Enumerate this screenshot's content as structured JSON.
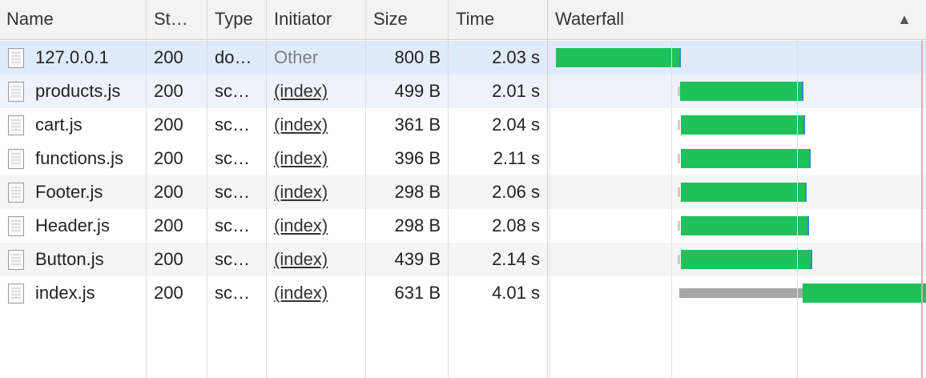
{
  "columns": {
    "name": "Name",
    "status": "St…",
    "type": "Type",
    "initiator": "Initiator",
    "size": "Size",
    "time": "Time",
    "waterfall": "Waterfall",
    "sort_indicator": "▲"
  },
  "rows": [
    {
      "name": "127.0.0.1",
      "status": "200",
      "type": "do…",
      "initiator": "Other",
      "size": "800 B",
      "time": "2.03 s"
    },
    {
      "name": "products.js",
      "status": "200",
      "type": "sc…",
      "initiator": "(index)",
      "size": "499 B",
      "time": "2.01 s"
    },
    {
      "name": "cart.js",
      "status": "200",
      "type": "sc…",
      "initiator": "(index)",
      "size": "361 B",
      "time": "2.04 s"
    },
    {
      "name": "functions.js",
      "status": "200",
      "type": "sc…",
      "initiator": "(index)",
      "size": "396 B",
      "time": "2.11 s"
    },
    {
      "name": "Footer.js",
      "status": "200",
      "type": "sc…",
      "initiator": "(index)",
      "size": "298 B",
      "time": "2.06 s"
    },
    {
      "name": "Header.js",
      "status": "200",
      "type": "sc…",
      "initiator": "(index)",
      "size": "298 B",
      "time": "2.08 s"
    },
    {
      "name": "Button.js",
      "status": "200",
      "type": "sc…",
      "initiator": "(index)",
      "size": "439 B",
      "time": "2.14 s"
    },
    {
      "name": "index.js",
      "status": "200",
      "type": "sc…",
      "initiator": "(index)",
      "size": "631 B",
      "time": "4.01 s"
    }
  ],
  "colors": {
    "selected_row": "#dfeafb",
    "waterfall_receive": "#1fc15a",
    "waterfall_waiting": "#a6a6a6",
    "waterfall_edge": "#2a8bd0",
    "load_marker": "#e6a8b8"
  },
  "icons": {
    "file": "document-file-icon",
    "sort": "sort-ascending-icon"
  }
}
